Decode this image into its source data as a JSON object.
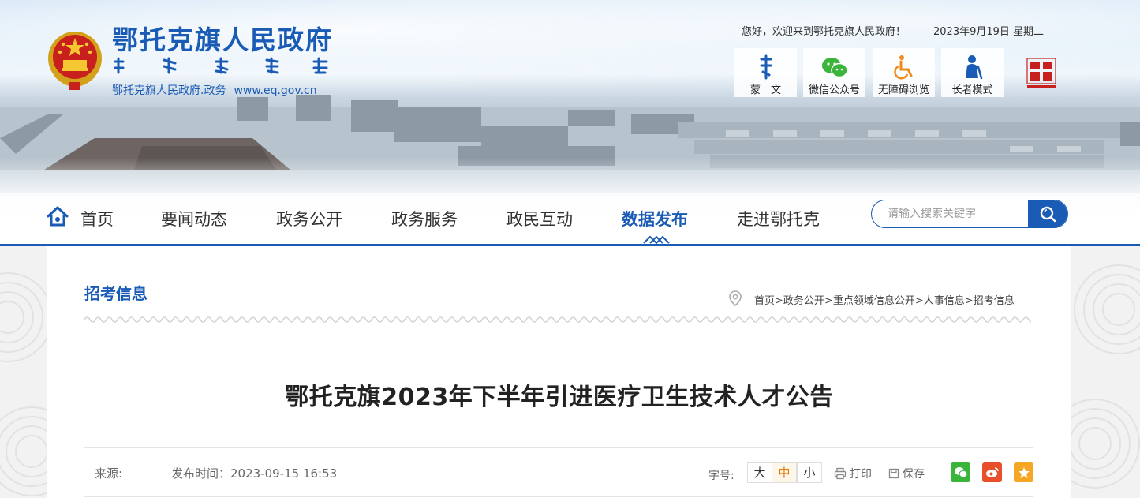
{
  "header": {
    "site_title": "鄂托克旗人民政府",
    "site_subtitle": "鄂托克旗人民政府.政务",
    "site_url": "www.eq.gov.cn",
    "welcome": "您好，欢迎来到鄂托克旗人民政府！",
    "date": "2023年9月19日 星期二",
    "tools": [
      {
        "label": "蒙　文",
        "icon": "mongolian-script-icon"
      },
      {
        "label": "微信公众号",
        "icon": "wechat-icon"
      },
      {
        "label": "无障碍浏览",
        "icon": "wheelchair-icon"
      },
      {
        "label": "长者模式",
        "icon": "elder-icon"
      }
    ]
  },
  "nav": {
    "items": [
      {
        "label": "首页"
      },
      {
        "label": "要闻动态"
      },
      {
        "label": "政务公开"
      },
      {
        "label": "政务服务"
      },
      {
        "label": "政民互动"
      },
      {
        "label": "数据发布",
        "active": true
      },
      {
        "label": "走进鄂托克"
      }
    ],
    "search_placeholder": "请输入搜索关键字"
  },
  "section": {
    "title": "招考信息",
    "breadcrumb": [
      "首页",
      "政务公开",
      "重点领域信息公开",
      "人事信息",
      "招考信息"
    ],
    "breadcrumb_sep": ">"
  },
  "article": {
    "title": "鄂托克旗2023年下半年引进医疗卫生技术人才公告",
    "source_label": "来源:",
    "publish_time": "发布时间：2023-09-15 16:53",
    "font_size_label": "字号:",
    "font_sizes": [
      "大",
      "中",
      "小"
    ],
    "print_label": "打印",
    "save_label": "保存"
  },
  "colors": {
    "brand_blue": "#1a5bb5",
    "wechat_green": "#3bb43c",
    "weibo_red": "#e8502c",
    "favorite_orange": "#f5a623"
  }
}
